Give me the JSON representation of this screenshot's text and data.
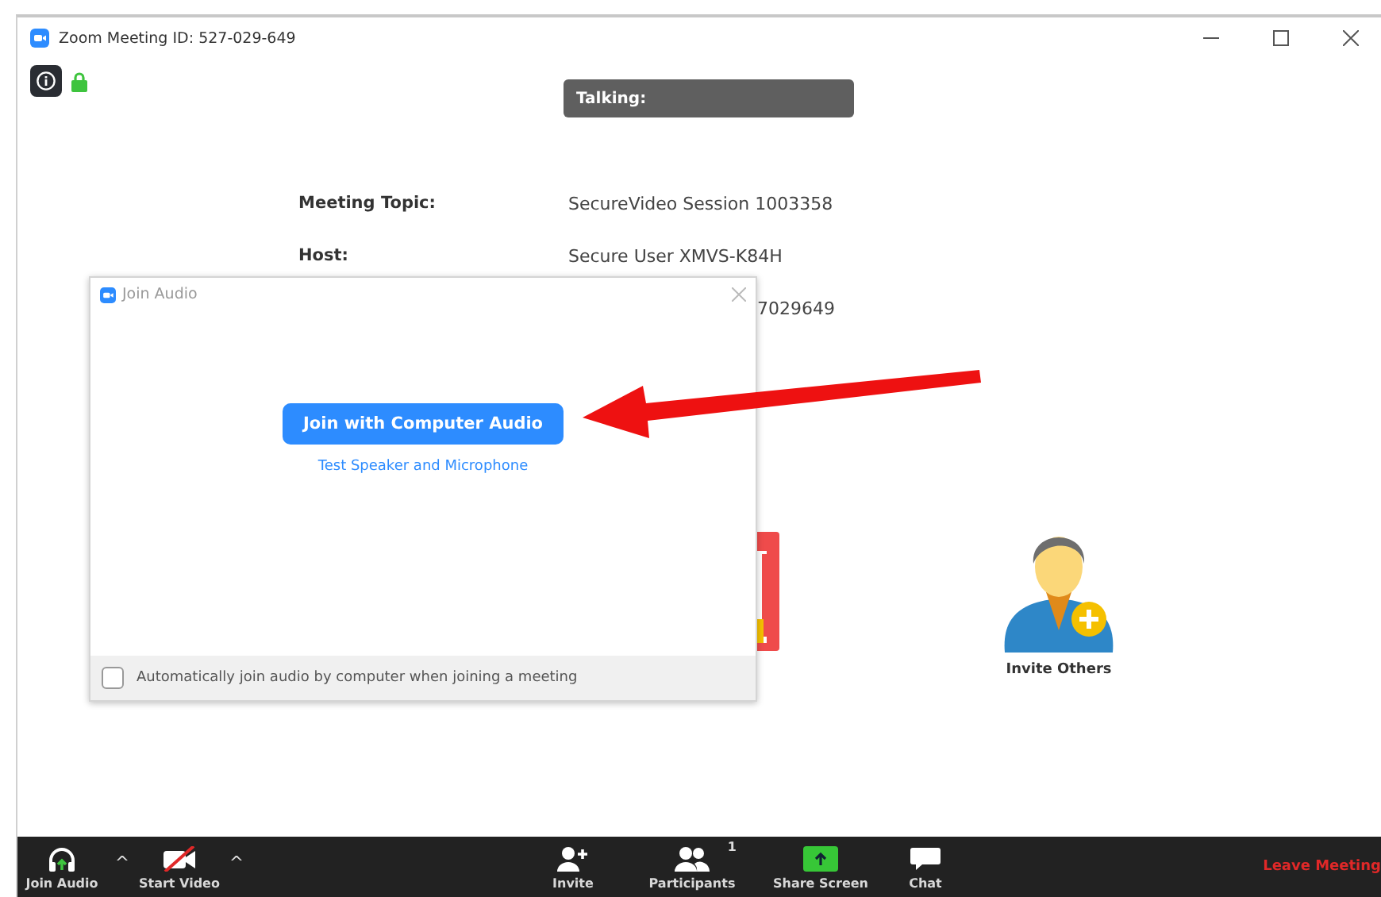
{
  "window": {
    "title": "Zoom Meeting ID: 527-029-649"
  },
  "talking_banner": {
    "label": "Talking:"
  },
  "meeting_info": [
    {
      "label": "Meeting Topic:",
      "value": "SecureVideo Session 1003358"
    },
    {
      "label": "Host:",
      "value": "Secure User XMVS-K84H"
    },
    {
      "value": "7029649"
    }
  ],
  "invite": {
    "label": "Invite Others"
  },
  "dialog": {
    "title": "Join Audio",
    "primary_button": "Join with Computer Audio",
    "link": "Test Speaker and Microphone",
    "auto_join": {
      "label": "Automatically join audio by computer when joining a meeting",
      "checked": false
    }
  },
  "toolbar": {
    "left": [
      {
        "kind": "audio",
        "label": "Join Audio"
      },
      {
        "kind": "caret",
        "label": "^"
      },
      {
        "kind": "video",
        "label": "Start Video"
      },
      {
        "kind": "caret",
        "label": "^"
      }
    ],
    "center": [
      {
        "kind": "invite",
        "label": "Invite"
      },
      {
        "kind": "participants",
        "label": "Participants",
        "count": "1"
      },
      {
        "kind": "share",
        "label": "Share Screen"
      },
      {
        "kind": "chat",
        "label": "Chat"
      }
    ],
    "leave": "Leave Meeting"
  }
}
